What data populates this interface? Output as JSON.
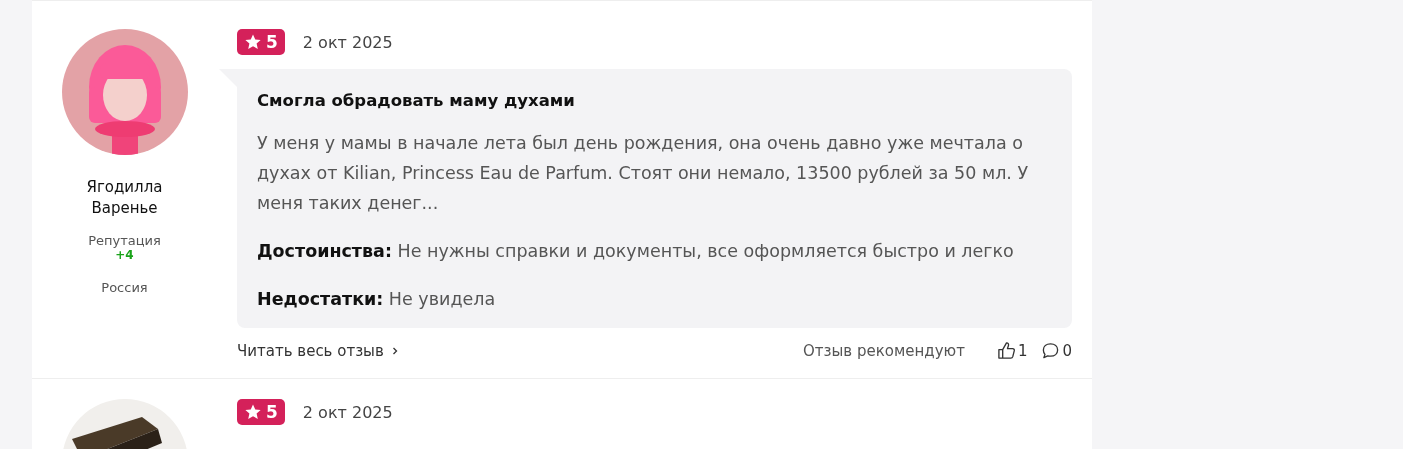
{
  "reviews": [
    {
      "author": {
        "name": "Ягодилла Варенье",
        "reputation_label": "Репутация",
        "reputation": "+4",
        "country": "Россия"
      },
      "rating": "5",
      "date": "2 окт 2025",
      "title": "Смогла обрадовать маму духами",
      "text": "У меня у мамы в начале лета был день рождения, она очень давно уже мечтала о духах от Kilian, Princess Eau de Parfum. Стоят они немало, 13500 рублей за 50 мл. У меня таких денег...",
      "pros_label": "Достоинства:",
      "pros": "Не нужны справки и документы, все оформляется быстро и легко",
      "cons_label": "Недостатки:",
      "cons": "Не увидела",
      "read_more": "Читать весь отзыв",
      "recommend_label": "Отзыв рекомендуют",
      "likes": "1",
      "comments": "0"
    },
    {
      "rating": "5",
      "date": "2 окт 2025"
    }
  ]
}
